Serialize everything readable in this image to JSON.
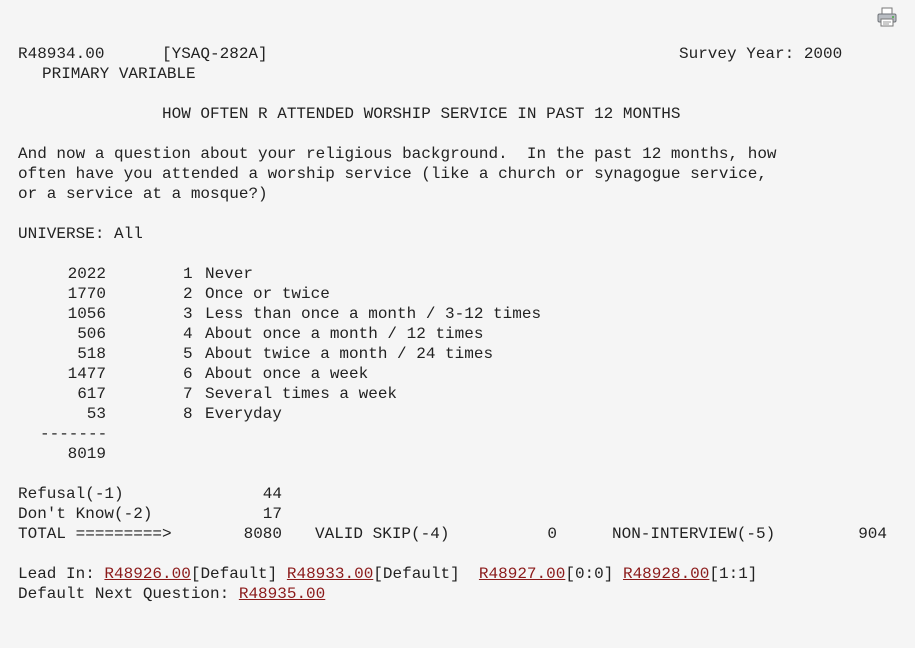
{
  "header": {
    "variable_id": "R48934.00",
    "question_code": "[YSAQ-282A]",
    "survey_year": "Survey Year: 2000",
    "variable_type": "PRIMARY VARIABLE"
  },
  "title": "HOW OFTEN R ATTENDED WORSHIP SERVICE IN PAST 12 MONTHS",
  "question_lines": [
    "And now a question about your religious background.  In the past 12 months, how",
    "often have you attended a worship service (like a church or synagogue service,",
    "or a service at a mosque?)"
  ],
  "universe": "UNIVERSE: All",
  "responses": [
    {
      "count": "2022",
      "code": "1",
      "label": "Never"
    },
    {
      "count": "1770",
      "code": "2",
      "label": "Once or twice"
    },
    {
      "count": "1056",
      "code": "3",
      "label": "Less than once a month / 3-12 times"
    },
    {
      "count": "506",
      "code": "4",
      "label": "About once a month / 12 times"
    },
    {
      "count": "518",
      "code": "5",
      "label": "About twice a month / 24 times"
    },
    {
      "count": "1477",
      "code": "6",
      "label": "About once a week"
    },
    {
      "count": "617",
      "code": "7",
      "label": "Several times a week"
    },
    {
      "count": "53",
      "code": "8",
      "label": "Everyday"
    }
  ],
  "separator": "-------",
  "subtotal": "8019",
  "refusal": {
    "label": "Refusal(-1)",
    "value": "44"
  },
  "dont_know": {
    "label": "Don't Know(-2)",
    "value": "17"
  },
  "total": {
    "label": "TOTAL =========>",
    "value": "8080"
  },
  "valid_skip": {
    "label": "VALID SKIP(-4)",
    "value": "0"
  },
  "non_interview": {
    "label": "NON-INTERVIEW(-5)",
    "value": "904"
  },
  "lead_in": {
    "label": "Lead In: ",
    "items": [
      {
        "link": "R48926.00",
        "suffix": "[Default]"
      },
      {
        "link": "R48933.00",
        "suffix": "[Default]"
      },
      {
        "link": "R48927.00",
        "suffix": "[0:0]"
      },
      {
        "link": "R48928.00",
        "suffix": "[1:1]"
      }
    ]
  },
  "next_question": {
    "label": "Default Next Question: ",
    "link": "R48935.00"
  },
  "icons": {
    "print": "printer-icon"
  }
}
